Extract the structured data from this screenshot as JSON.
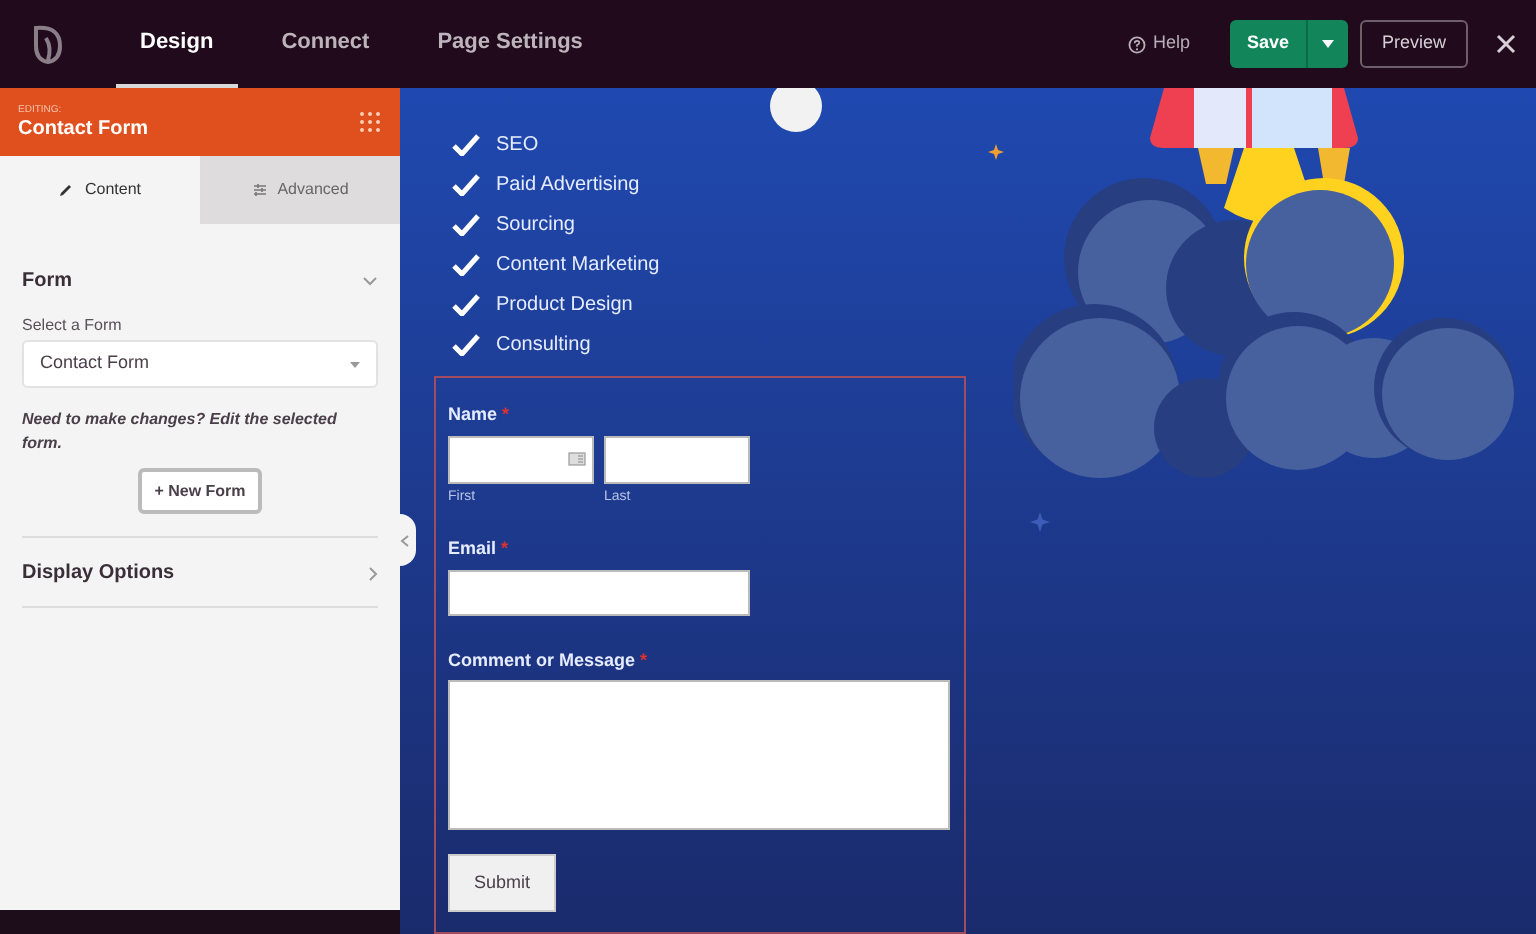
{
  "top_bar": {
    "tabs": [
      {
        "label": "Design",
        "selected": true
      },
      {
        "label": "Connect",
        "selected": false
      },
      {
        "label": "Page Settings",
        "selected": false
      }
    ],
    "help": "Help",
    "save": "Save",
    "preview": "Preview"
  },
  "sidebar": {
    "editing_label": "EDITING:",
    "title": "Contact Form",
    "tabs": [
      {
        "label": "Content",
        "kind": "pencil",
        "selected": true
      },
      {
        "label": "Advanced",
        "kind": "sliders",
        "selected": false
      }
    ],
    "sections": [
      {
        "title": "Form",
        "expanded": true,
        "select_label": "Select a Form",
        "select_value": "Contact Form",
        "note": "Need to make changes? Edit the selected form.",
        "button": "+ New Form"
      },
      {
        "title": "Display Options",
        "expanded": false
      }
    ]
  },
  "canvas": {
    "checklist": [
      "SEO",
      "Paid Advertising",
      "Sourcing",
      "Content Marketing",
      "Product Design",
      "Consulting"
    ],
    "form": {
      "fields": [
        {
          "kind": "name",
          "label": "Name",
          "required_mark": "*",
          "sublabels": [
            "First",
            "Last"
          ]
        },
        {
          "kind": "email",
          "label": "Email",
          "required_mark": "*"
        },
        {
          "kind": "textarea",
          "label": "Comment or Message",
          "required_mark": "*"
        }
      ],
      "submit": "Submit"
    }
  }
}
